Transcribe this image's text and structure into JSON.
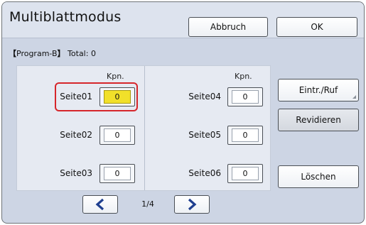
{
  "title": "Multiblattmodus",
  "buttons": {
    "cancel": "Abbruch",
    "ok": "OK",
    "register": "Eintr./Ruf",
    "revise": "Revidieren",
    "delete": "Löschen"
  },
  "program": {
    "name": "Program-B",
    "total_label": "Total: 0"
  },
  "columns": {
    "header": "Kpn."
  },
  "pages": [
    {
      "label": "Seite01",
      "value": "0",
      "selected": true
    },
    {
      "label": "Seite02",
      "value": "0",
      "selected": false
    },
    {
      "label": "Seite03",
      "value": "0",
      "selected": false
    },
    {
      "label": "Seite04",
      "value": "0",
      "selected": false
    },
    {
      "label": "Seite05",
      "value": "0",
      "selected": false
    },
    {
      "label": "Seite06",
      "value": "0",
      "selected": false
    }
  ],
  "pagination": {
    "indicator": "1/4"
  },
  "colors": {
    "background": "#cdd5e4",
    "selected_value": "#f1e02a",
    "highlight": "#d6262b",
    "nav_arrow": "#1f3f8f"
  },
  "icons": {
    "prev": "chevron-left-icon",
    "next": "chevron-right-icon"
  }
}
